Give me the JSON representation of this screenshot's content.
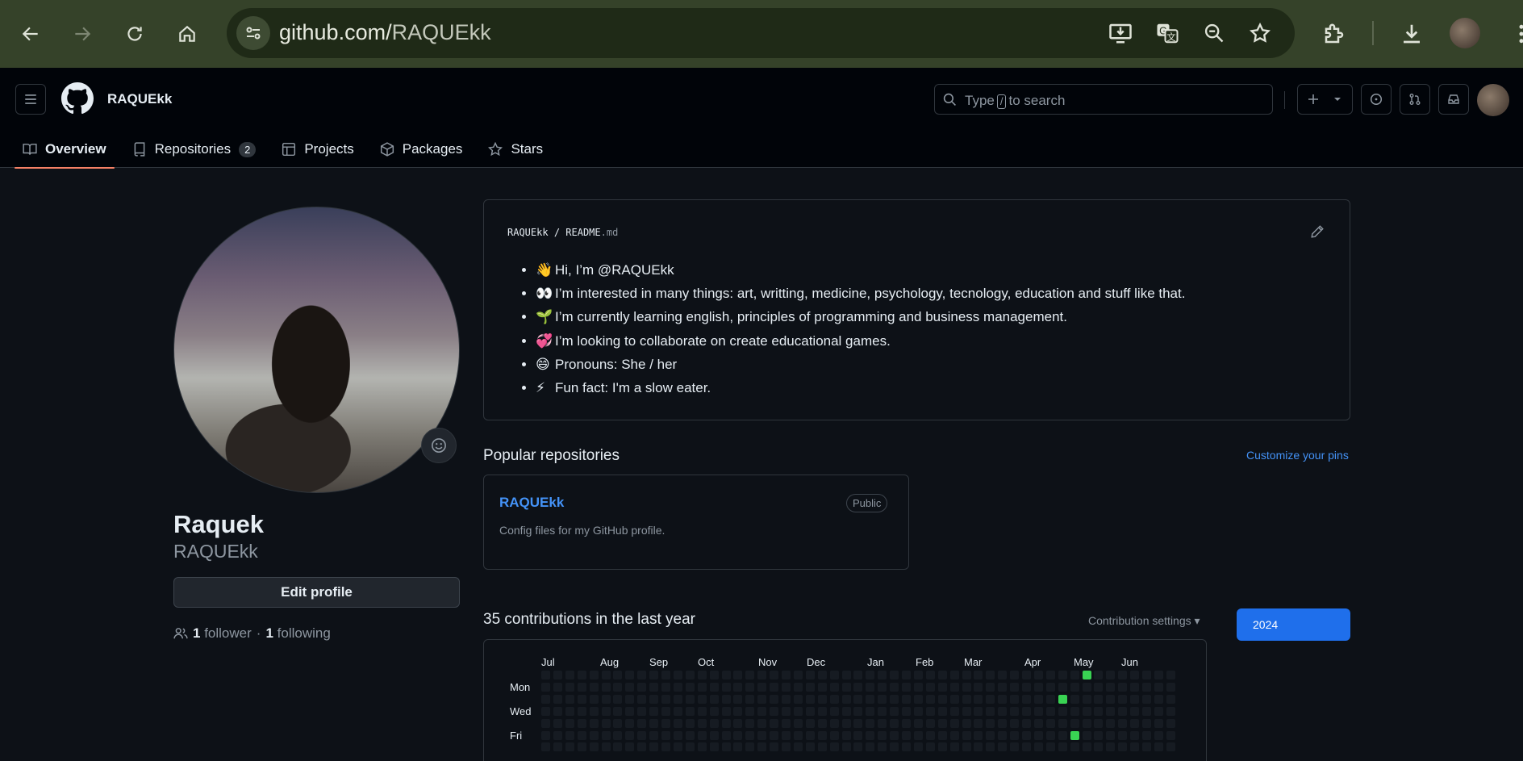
{
  "browser": {
    "url_host": "github.com/",
    "url_path": "RAQUEkk"
  },
  "header": {
    "username": "RAQUEkk",
    "search_text_before": "Type",
    "search_key": "/",
    "search_text_after": "to search"
  },
  "tabs": [
    {
      "label": "Overview",
      "icon": "book-icon",
      "active": true
    },
    {
      "label": "Repositories",
      "icon": "repo-icon",
      "count": "2"
    },
    {
      "label": "Projects",
      "icon": "table-icon"
    },
    {
      "label": "Packages",
      "icon": "package-icon"
    },
    {
      "label": "Stars",
      "icon": "star-icon"
    }
  ],
  "profile": {
    "name": "Raquek",
    "login": "RAQUEkk",
    "edit_label": "Edit profile",
    "followers_count": "1",
    "followers_label": "follower",
    "dot": "·",
    "following_count": "1",
    "following_label": "following"
  },
  "readme": {
    "owner": "RAQUEkk",
    "sep": "/",
    "file": "README",
    "ext": ".md",
    "items": [
      {
        "emoji": "👋",
        "text": "Hi, I’m @RAQUEkk"
      },
      {
        "emoji": "👀",
        "text": "I’m interested in many things: art, writting, medicine, psychology, tecnology, education and stuff like that."
      },
      {
        "emoji": "🌱",
        "text": "I’m currently learning english, principles of programming and business management."
      },
      {
        "emoji": "💞️",
        "text": "I’m looking to collaborate on create educational games."
      },
      {
        "emoji": "😄",
        "text": "Pronouns: She / her"
      },
      {
        "emoji": "⚡",
        "text": "Fun fact: I'm a slow eater."
      }
    ]
  },
  "popular": {
    "title": "Popular repositories",
    "customize": "Customize your pins",
    "repos": [
      {
        "name": "RAQUEkk",
        "visibility": "Public",
        "description": "Config files for my GitHub profile."
      }
    ]
  },
  "contributions": {
    "title": "35 contributions in the last year",
    "settings": "Contribution settings ▾",
    "year": "2024",
    "months": [
      "Jul",
      "Aug",
      "Sep",
      "Oct",
      "Nov",
      "Dec",
      "Jan",
      "Feb",
      "Mar",
      "Apr",
      "May",
      "Jun"
    ],
    "days": [
      "Mon",
      "Wed",
      "Fri"
    ],
    "active_cells": [
      [
        45,
        0
      ],
      [
        43,
        2
      ],
      [
        44,
        5
      ]
    ],
    "accent": "#39d353"
  }
}
